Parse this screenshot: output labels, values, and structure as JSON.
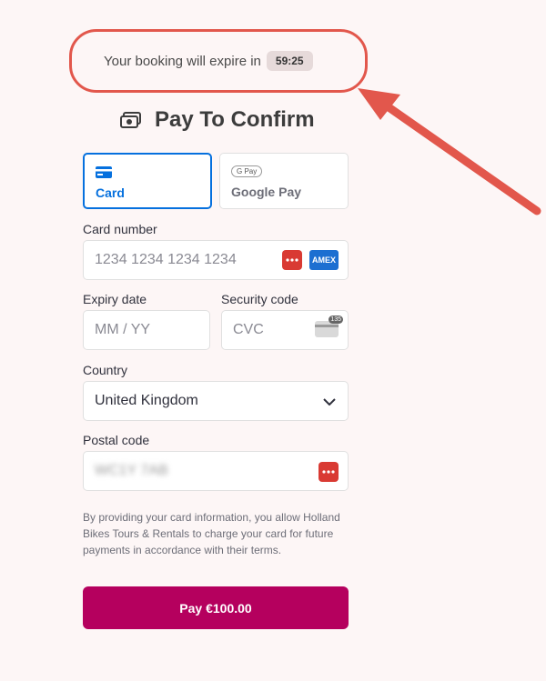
{
  "timer": {
    "text": "Your booking will expire in",
    "time": "59:25"
  },
  "title": "Pay To Confirm",
  "tabs": {
    "card": "Card",
    "google_pay": "Google Pay",
    "gpay_badge": "G Pay"
  },
  "card_number": {
    "label": "Card number",
    "placeholder": "1234 1234 1234 1234",
    "brand_badge": "AMEX"
  },
  "expiry": {
    "label": "Expiry date",
    "placeholder": "MM / YY"
  },
  "security": {
    "label": "Security code",
    "placeholder": "CVC",
    "cvc_badge": "135"
  },
  "country": {
    "label": "Country",
    "value": "United Kingdom"
  },
  "postal": {
    "label": "Postal code",
    "value": "WC1Y 7AB"
  },
  "terms": "By providing your card information, you allow Holland Bikes Tours & Rentals to charge your card for future payments in accordance with their terms.",
  "pay_button": "Pay €100.00",
  "colors": {
    "accent": "#0570de",
    "pay": "#b5005e",
    "annotation": "#e2574c"
  }
}
